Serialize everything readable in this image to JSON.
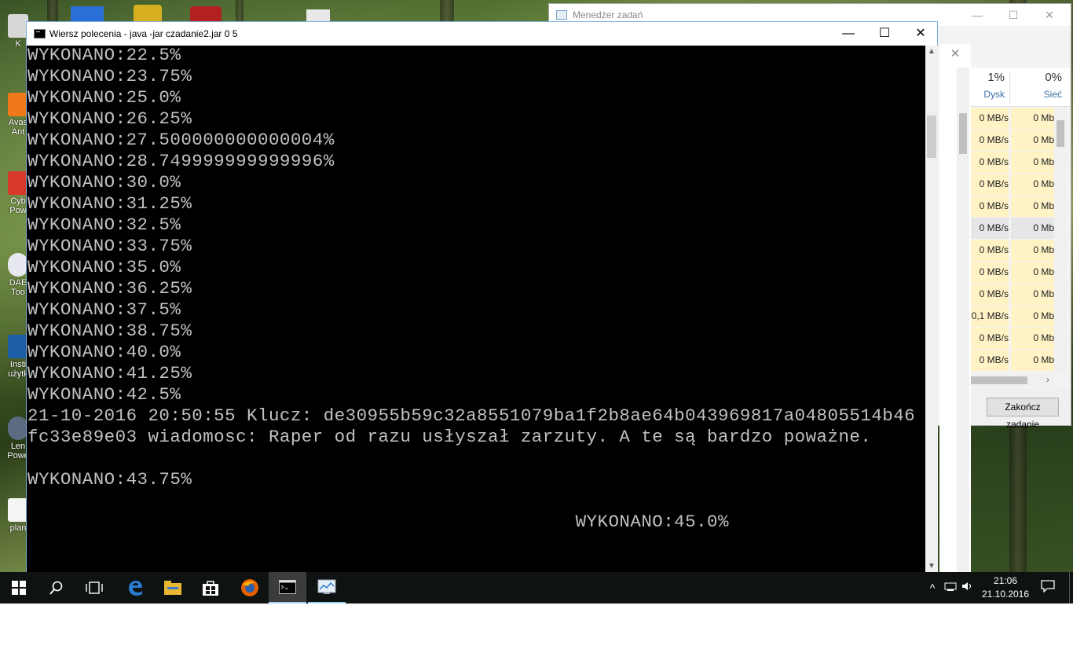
{
  "cmd_window": {
    "title": "Wiersz polecenia - java  -jar czadanie2.jar 0 5",
    "minimize": "—",
    "maximize": "☐",
    "close": "✕",
    "lines": [
      "WYKONANO:22.5%",
      "WYKONANO:23.75%",
      "WYKONANO:25.0%",
      "WYKONANO:26.25%",
      "WYKONANO:27.500000000000004%",
      "WYKONANO:28.749999999999996%",
      "WYKONANO:30.0%",
      "WYKONANO:31.25%",
      "WYKONANO:32.5%",
      "WYKONANO:33.75%",
      "WYKONANO:35.0%",
      "WYKONANO:36.25%",
      "WYKONANO:37.5%",
      "WYKONANO:38.75%",
      "WYKONANO:40.0%",
      "WYKONANO:41.25%",
      "WYKONANO:42.5%",
      "21-10-2016 20:50:55 Klucz: de30955b59c32a8551079ba1f2b8ae64b043969817a04805514b46",
      "fc33e89e03 wiadomosc: Raper od razu usłyszał zarzuty. A te są bardzo poważne.",
      "",
      "WYKONANO:43.75%",
      "",
      "                                                  WYKONANO:45.0%"
    ]
  },
  "task_manager": {
    "title": "Menedżer zadań",
    "close_inner": "✕",
    "columns": [
      {
        "percent": "1%",
        "name": "Dysk"
      },
      {
        "percent": "0%",
        "name": "Sieć"
      }
    ],
    "disk_values": [
      "0 MB/s",
      "0 MB/s",
      "0 MB/s",
      "0 MB/s",
      "0 MB/s",
      "0 MB/s",
      "0 MB/s",
      "0 MB/s",
      "0 MB/s",
      "0,1 MB/s",
      "0 MB/s",
      "0 MB/s"
    ],
    "net_values": [
      "0 Mb",
      "0 Mb",
      "0 Mb",
      "0 Mb",
      "0 Mb",
      "0 Mb",
      "0 Mb",
      "0 Mb",
      "0 Mb",
      "0 Mb",
      "0 Mb",
      "0 Mb"
    ],
    "end_task_label": "Zakończ zadanie"
  },
  "desktop_icons": [
    {
      "label": "K",
      "icon": "recycle-bin-icon"
    },
    {
      "label": "Avas Ant",
      "icon": "avast-icon"
    },
    {
      "label": "Cyb Pow",
      "icon": "cyberlink-icon"
    },
    {
      "label": "DAE Too",
      "icon": "daemon-tools-icon"
    },
    {
      "label": "Insti użytk",
      "icon": "lenovo-icon"
    },
    {
      "label": "Len Powe",
      "icon": "lenovo-power-icon"
    },
    {
      "label": "plan",
      "icon": "document-icon"
    }
  ],
  "taskbar": {
    "start": "start-icon",
    "items": [
      "search-icon",
      "task-view-icon",
      "edge-icon",
      "file-explorer-icon",
      "store-icon",
      "firefox-icon",
      "cmd-icon",
      "task-manager-icon"
    ],
    "time": "21:06",
    "date": "21.10.2016"
  },
  "colors": {
    "console_text": "#c0c0c0",
    "console_bg": "#000000",
    "taskbar_bg": "#0e1210",
    "tm_highlight": "#fff3c6"
  }
}
